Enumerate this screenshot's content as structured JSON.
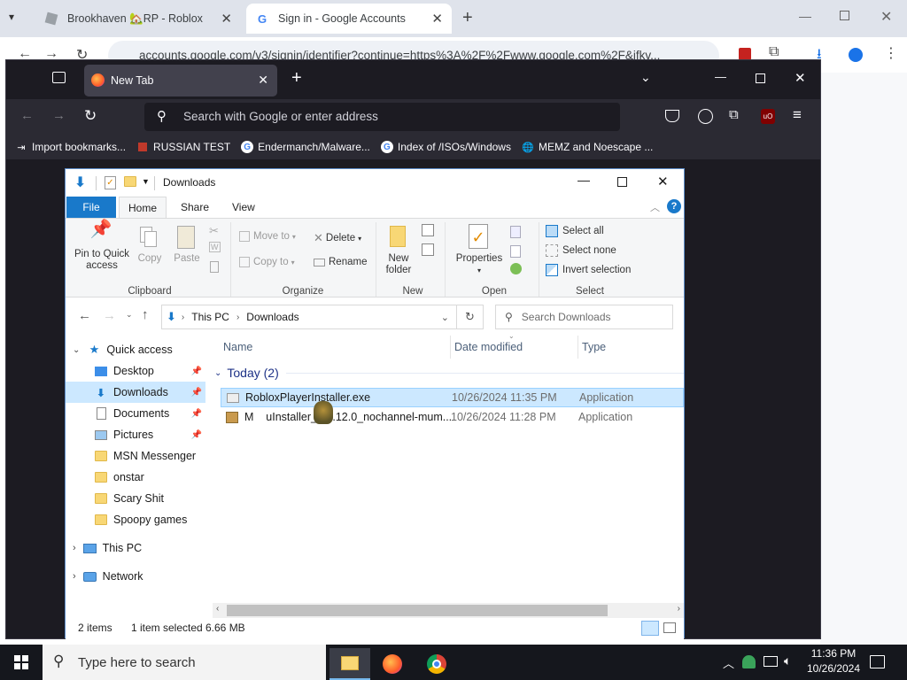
{
  "chrome": {
    "tabs": [
      {
        "title": "Brookhaven 🏡RP - Roblox"
      },
      {
        "title": "Sign in - Google Accounts"
      }
    ],
    "url": "accounts.google.com/v3/signin/identifier?continue=https%3A%2F%2Fwww.google.com%2F&ifkv..."
  },
  "firefox": {
    "tab_title": "New Tab",
    "url_placeholder": "Search with Google or enter address",
    "bookmarks": [
      {
        "label": "Import bookmarks...",
        "icon": "import-icon"
      },
      {
        "label": "RUSSIAN TEST",
        "icon": "red-square-icon"
      },
      {
        "label": "Endermanch/Malware...",
        "icon": "google-icon"
      },
      {
        "label": "Index of /ISOs/Windows",
        "icon": "google-icon"
      },
      {
        "label": "MEMZ and Noescape ...",
        "icon": "globe-icon"
      }
    ],
    "ublock_badge": "uO"
  },
  "explorer": {
    "title": "Downloads",
    "ribbon_tabs": [
      "File",
      "Home",
      "Share",
      "View"
    ],
    "clipboard": {
      "pin": "Pin to Quick access",
      "copy": "Copy",
      "paste": "Paste",
      "label": "Clipboard"
    },
    "organize": {
      "move_to": "Move to",
      "copy_to": "Copy to",
      "delete": "Delete",
      "rename": "Rename",
      "label": "Organize"
    },
    "new": {
      "new_folder": "New folder",
      "label": "New"
    },
    "open": {
      "properties": "Properties",
      "label": "Open"
    },
    "select": {
      "select_all": "Select all",
      "select_none": "Select none",
      "invert": "Invert selection",
      "label": "Select"
    },
    "breadcrumb": [
      "This PC",
      "Downloads"
    ],
    "search_placeholder": "Search Downloads",
    "nav": {
      "quick_access": "Quick access",
      "items": [
        {
          "label": "Desktop",
          "pinned": true
        },
        {
          "label": "Downloads",
          "pinned": true
        },
        {
          "label": "Documents",
          "pinned": true
        },
        {
          "label": "Pictures",
          "pinned": true
        },
        {
          "label": "MSN Messenger",
          "pinned": false
        },
        {
          "label": "onstar",
          "pinned": false
        },
        {
          "label": "Scary Shit",
          "pinned": false
        },
        {
          "label": "Spoopy games",
          "pinned": false
        }
      ],
      "this_pc": "This PC",
      "network": "Network"
    },
    "columns": {
      "name": "Name",
      "date": "Date modified",
      "type": "Type"
    },
    "group": "Today (2)",
    "files": [
      {
        "name": "RobloxPlayerInstaller.exe",
        "date": "10/26/2024 11:35 PM",
        "type": "Application"
      },
      {
        "name": "MEMZInstaller_3.1.12.0_nochannel-mum...",
        "name_visible": "M    uInstaller_3.1.12.0_nochannel-mum...",
        "date": "10/26/2024 11:28 PM",
        "type": "Application"
      }
    ],
    "status": {
      "count": "2 items",
      "selected": "1 item selected",
      "size": "6.66 MB"
    }
  },
  "taskbar": {
    "search_placeholder": "Type here to search",
    "time": "11:36 PM",
    "date": "10/26/2024"
  },
  "colors": {
    "accent": "#1979ca",
    "firefox_bg": "#1c1b22",
    "selection": "#cce8ff"
  }
}
